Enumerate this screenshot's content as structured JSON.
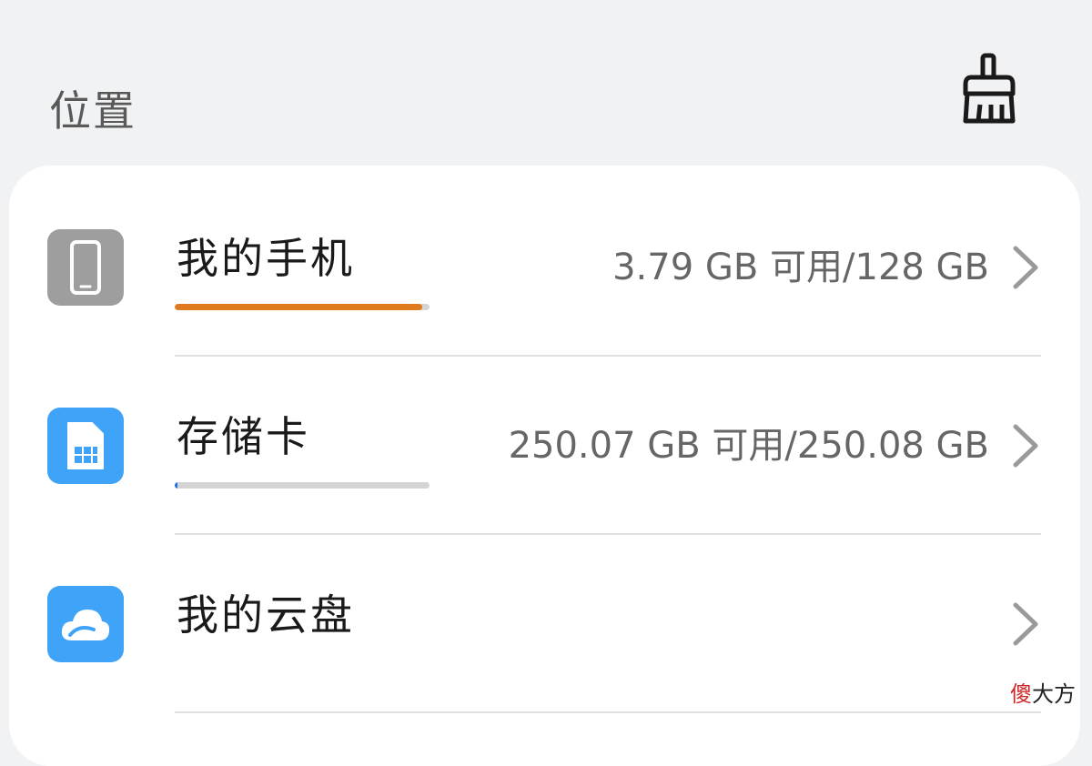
{
  "header": {
    "title": "位置"
  },
  "colors": {
    "page_background": "#f1f2f4",
    "card_background": "#ffffff",
    "phone_icon_bg": "#9e9e9e",
    "blue_icon_bg": "#3fa3f7",
    "phone_bar_fill": "#e07a1f",
    "sd_bar_fill": "#1a73e8",
    "bar_track": "#d4d4d4"
  },
  "icons": {
    "clean": "broom-icon",
    "phone": "smartphone-icon",
    "sd": "sd-card-icon",
    "cloud": "cloud-icon",
    "chevron": "chevron-right-icon"
  },
  "storage": {
    "items": [
      {
        "title": "我的手机",
        "value": "3.79 GB 可用/128 GB",
        "used_fraction": 0.97
      },
      {
        "title": "存储卡",
        "value": "250.07 GB 可用/250.08 GB",
        "used_fraction": 0.01
      },
      {
        "title": "我的云盘",
        "value": ""
      }
    ]
  },
  "watermark": {
    "part1": "傻",
    "part2": "大方"
  }
}
